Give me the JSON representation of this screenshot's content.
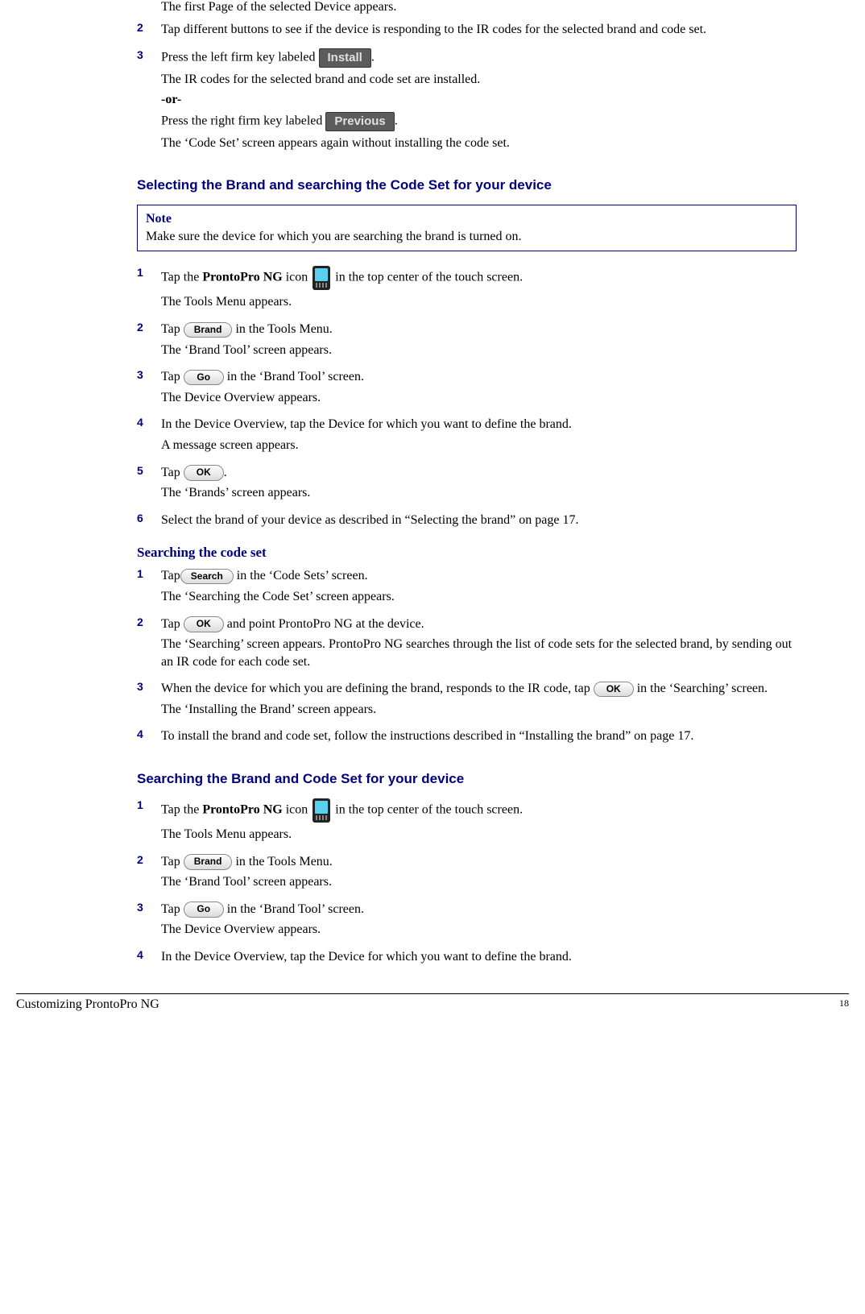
{
  "intro_line": "The first Page of the selected Device appears.",
  "topsteps": [
    {
      "num": "2",
      "lines": [
        "Tap different buttons to see if the device is responding to the IR codes for the selected brand and code set."
      ]
    }
  ],
  "step3": {
    "num": "3",
    "pre": "Press the left firm key labeled ",
    "install": "Install",
    "after_install": ".",
    "line2": "The IR codes for the selected brand and code set are installed.",
    "or": "-or-",
    "pre2": "Press the right firm key labeled ",
    "previous": "Previous",
    "after_prev": ".",
    "line5": "The ‘Code Set’ screen appears again without installing the code set."
  },
  "section1_title": "Selecting the Brand and searching the Code Set for your device",
  "note": {
    "title": "Note",
    "body": "Make sure the device for which you are searching the brand is turned on."
  },
  "sel_steps": {
    "s1": {
      "num": "1",
      "pre": "Tap the ",
      "bold": "ProntoPro NG",
      "mid": " icon ",
      "post": " in the top center of the touch screen.",
      "line2": "The Tools Menu appears."
    },
    "s2": {
      "num": "2",
      "pre": "Tap ",
      "btn": "Brand",
      "post": " in the Tools Menu.",
      "line2": "The ‘Brand Tool’ screen appears."
    },
    "s3": {
      "num": "3",
      "pre": "Tap ",
      "btn": "Go",
      "post": " in the ‘Brand Tool’ screen.",
      "line2": "The Device Overview appears."
    },
    "s4": {
      "num": "4",
      "line1": "In the Device Overview, tap the Device for which you want to define the brand.",
      "line2": "A message screen appears."
    },
    "s5": {
      "num": "5",
      "pre": "Tap ",
      "btn": "OK",
      "post": ".",
      "line2": "The ‘Brands’ screen appears."
    },
    "s6": {
      "num": "6",
      "line1": "Select the brand of your device as described in “Selecting the brand” on page 17."
    }
  },
  "subsection_title": "Searching the code set",
  "search_steps": {
    "s1": {
      "num": "1",
      "pre": "Tap",
      "btn": "Search",
      "post": " in the ‘Code Sets’ screen.",
      "line2": "The ‘Searching the Code Set’ screen appears."
    },
    "s2": {
      "num": "2",
      "pre": "Tap ",
      "btn": "OK",
      "post": " and point ProntoPro NG at the device.",
      "line2": "The ‘Searching’ screen appears. ProntoPro NG searches through the list of code sets for the selected brand, by sending out an IR code for each code set."
    },
    "s3": {
      "num": "3",
      "pre": "When the device for which you are defining the brand, responds to the IR code, tap ",
      "btn": "OK",
      "post": " in the ‘Searching’ screen.",
      "line2": "The ‘Installing the Brand’ screen appears."
    },
    "s4": {
      "num": "4",
      "line1": "To install the brand and code set, follow the instructions described in “Installing the brand” on page 17."
    }
  },
  "section2_title": "Searching the Brand and Code Set for your device",
  "sec2_steps": {
    "s1": {
      "num": "1",
      "pre": "Tap the ",
      "bold": "ProntoPro NG",
      "mid": " icon ",
      "post": " in the top center of the touch screen.",
      "line2": "The Tools Menu appears."
    },
    "s2": {
      "num": "2",
      "pre": "Tap ",
      "btn": "Brand",
      "post": " in the Tools Menu.",
      "line2": "The ‘Brand Tool’ screen appears."
    },
    "s3": {
      "num": "3",
      "pre": "Tap ",
      "btn": "Go",
      "post": " in the ‘Brand Tool’ screen.",
      "line2": "The Device Overview appears."
    },
    "s4": {
      "num": "4",
      "line1": "In the Device Overview, tap the Device for which you want to define the brand."
    }
  },
  "footer_left": "Customizing ProntoPro NG",
  "footer_page": "18"
}
